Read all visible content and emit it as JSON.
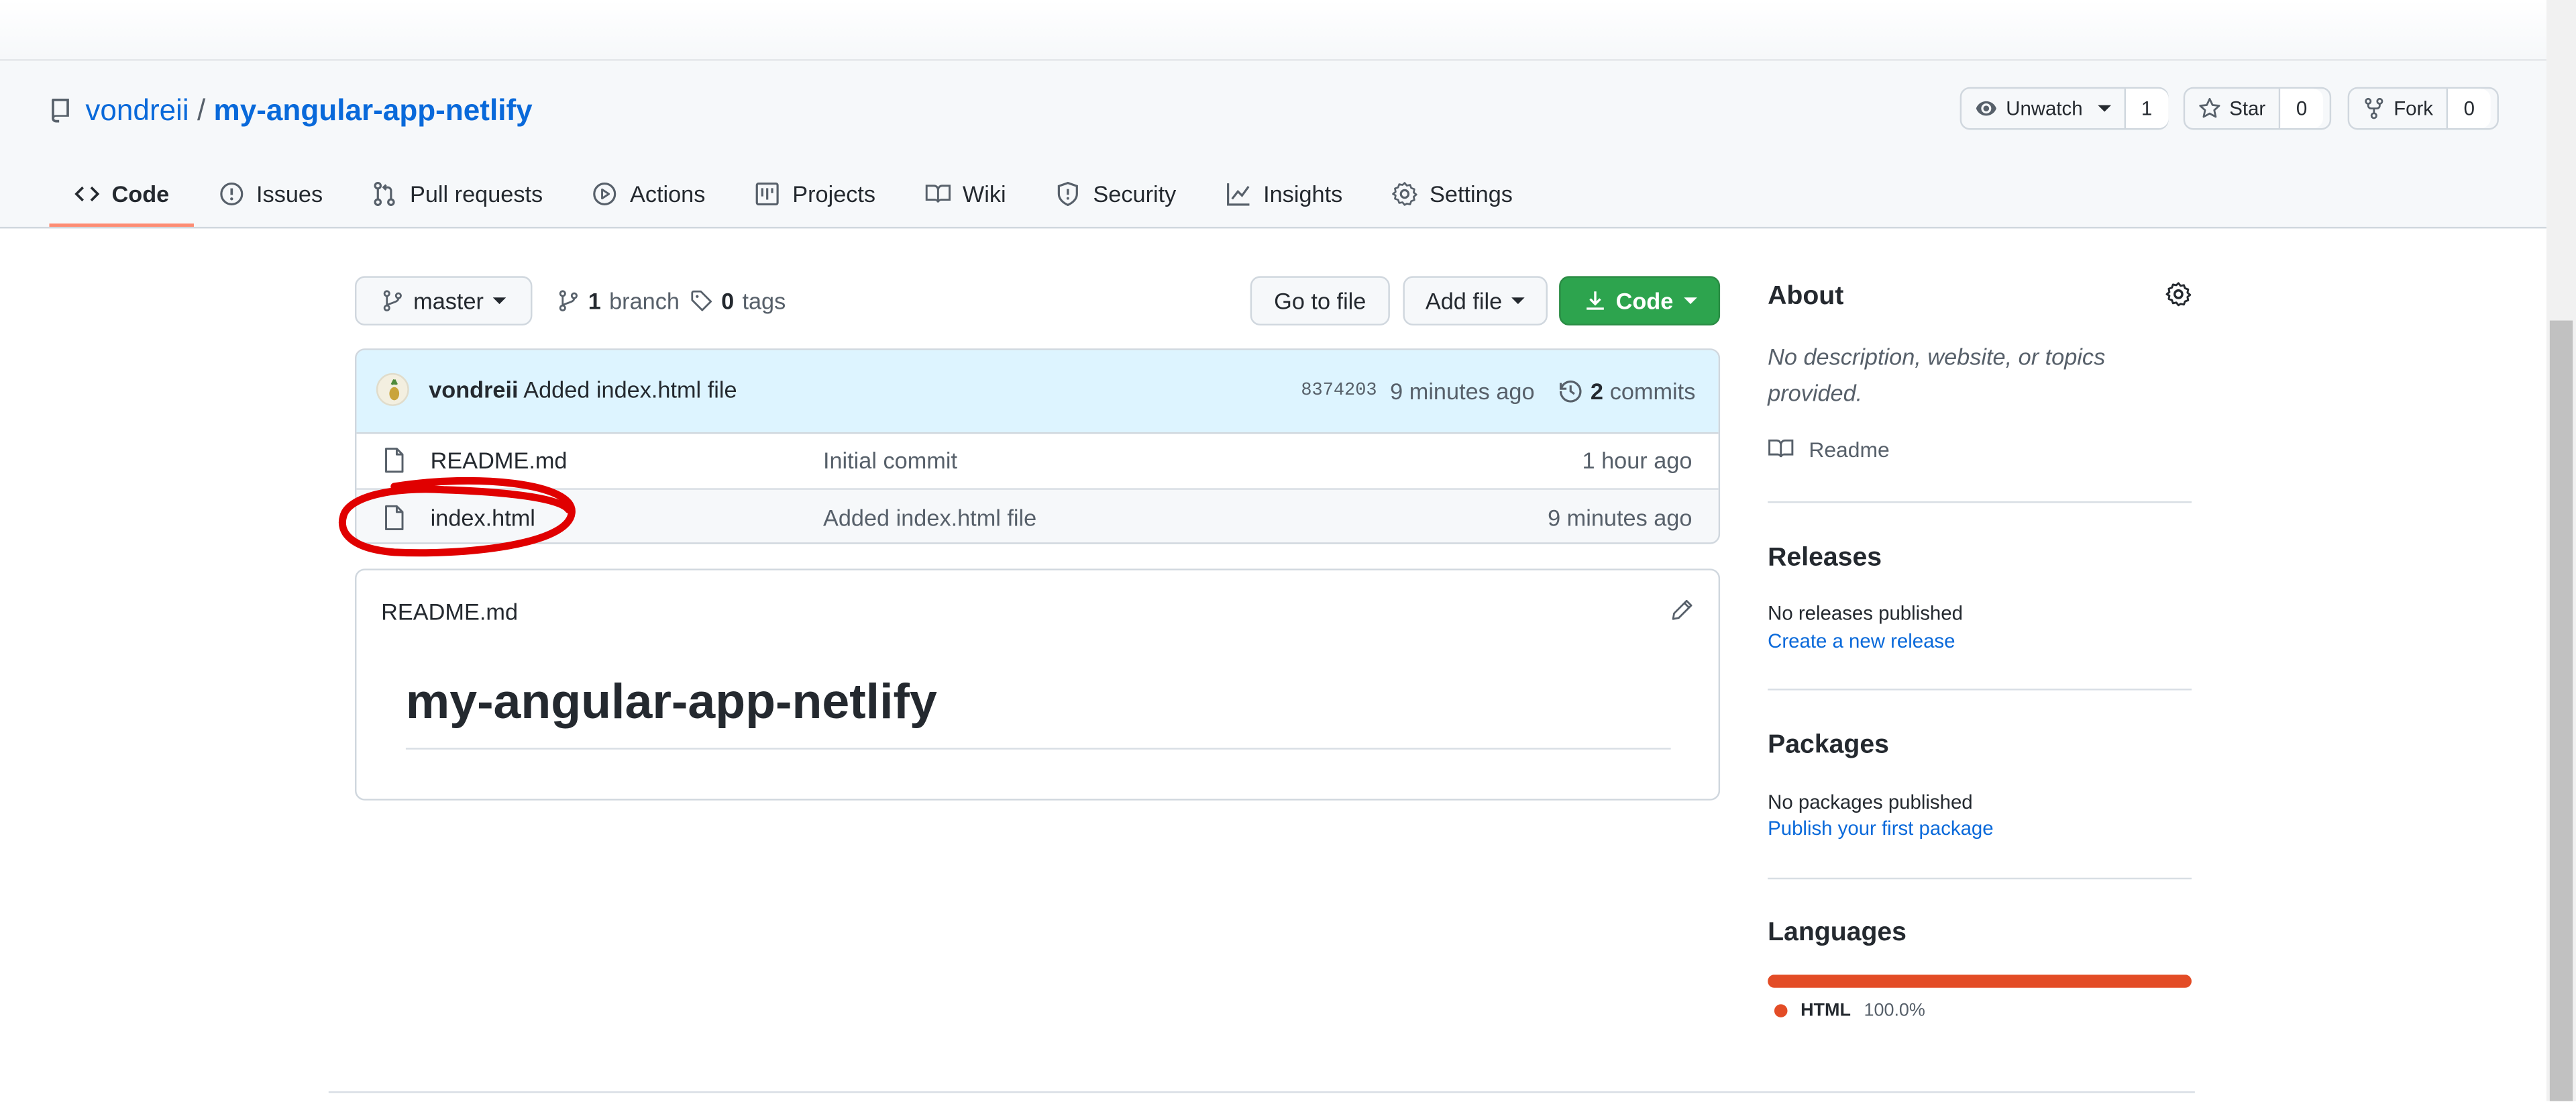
{
  "repo": {
    "owner": "vondreii",
    "separator": "/",
    "name": "my-angular-app-netlify"
  },
  "actions": {
    "watch": {
      "label": "Unwatch",
      "count": "1"
    },
    "star": {
      "label": "Star",
      "count": "0"
    },
    "fork": {
      "label": "Fork",
      "count": "0"
    }
  },
  "tabs": [
    {
      "label": "Code",
      "icon": "code-icon"
    },
    {
      "label": "Issues",
      "icon": "issue-icon"
    },
    {
      "label": "Pull requests",
      "icon": "pull-request-icon"
    },
    {
      "label": "Actions",
      "icon": "play-icon"
    },
    {
      "label": "Projects",
      "icon": "project-icon"
    },
    {
      "label": "Wiki",
      "icon": "book-icon"
    },
    {
      "label": "Security",
      "icon": "shield-icon"
    },
    {
      "label": "Insights",
      "icon": "graph-icon"
    },
    {
      "label": "Settings",
      "icon": "gear-icon"
    }
  ],
  "branch": {
    "current": "master",
    "branch_count": "1",
    "branch_label": "branch",
    "tag_count": "0",
    "tag_label": "tags",
    "go_to_file": "Go to file",
    "add_file": "Add file",
    "code": "Code"
  },
  "commit": {
    "author": "vondreii",
    "message": "Added index.html file",
    "sha": "8374203",
    "time": "9 minutes ago",
    "commits_count": "2",
    "commits_label": "commits"
  },
  "files": [
    {
      "name": "README.md",
      "message": "Initial commit",
      "age": "1 hour ago"
    },
    {
      "name": "index.html",
      "message": "Added index.html file",
      "age": "9 minutes ago"
    }
  ],
  "readme": {
    "filename": "README.md",
    "heading": "my-angular-app-netlify"
  },
  "sidebar": {
    "about_title": "About",
    "about_desc": "No description, website, or topics provided.",
    "readme_link": "Readme",
    "releases_title": "Releases",
    "releases_text": "No releases published",
    "releases_link": "Create a new release",
    "packages_title": "Packages",
    "packages_text": "No packages published",
    "packages_link": "Publish your first package",
    "languages_title": "Languages",
    "languages": [
      {
        "name": "HTML",
        "percent": "100.0%",
        "fraction": 1.0,
        "color": "#e34c26"
      }
    ]
  },
  "colors": {
    "accent": "#0969da",
    "primary_button": "#2da44e",
    "annotation": "#e00000",
    "tab_underline": "#fd8c73"
  }
}
